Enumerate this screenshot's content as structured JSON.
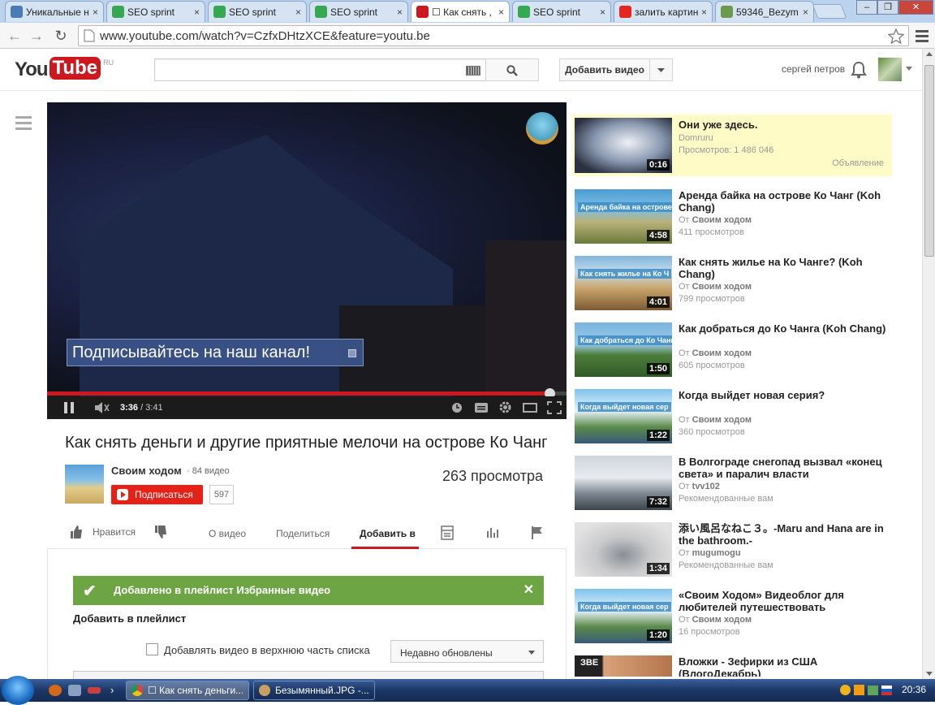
{
  "browser": {
    "tabs": [
      {
        "label": "Уникальные н",
        "icon": "site-icon",
        "color": "#4b7bb5",
        "active": false
      },
      {
        "label": "SEO sprint",
        "icon": "seosprint-icon",
        "color": "#36a852",
        "active": false
      },
      {
        "label": "SEO sprint",
        "icon": "seosprint-icon",
        "color": "#36a852",
        "active": false
      },
      {
        "label": "SEO sprint",
        "icon": "seosprint-icon",
        "color": "#36a852",
        "active": false
      },
      {
        "label": "☐ Как снять ,",
        "icon": "youtube-icon",
        "color": "#cc181e",
        "active": true
      },
      {
        "label": "SEO sprint",
        "icon": "seosprint-icon",
        "color": "#36a852",
        "active": false
      },
      {
        "label": "залить картин",
        "icon": "yandex-icon",
        "color": "#e52620",
        "active": false
      },
      {
        "label": "59346_Bezym",
        "icon": "image-icon",
        "color": "#6c9a4a",
        "active": false
      }
    ],
    "tab_close": "×",
    "window": {
      "minimize": "–",
      "restore": "❐",
      "close": "✕"
    },
    "url": "www.youtube.com/watch?v=CzfxDHtzXCE&feature=youtu.be"
  },
  "header": {
    "logo_you": "You",
    "logo_tube": "Tube",
    "logo_region": "RU",
    "add_video": "Добавить видео",
    "username": "сергей петров"
  },
  "player": {
    "annotation": "Подписывайтесь на наш канал!",
    "time_current": "3:36",
    "time_total": " / 3:41",
    "progress": 0.977
  },
  "video": {
    "title": "Как снять деньги и другие приятные мелочи на острове Ко Чанг",
    "channel": "Своим ходом",
    "channel_videos": "· 84 видео",
    "subscribe": "Подписаться",
    "subscribers": "597",
    "views": "263 просмотра"
  },
  "actions": {
    "like": "Нравится",
    "about": "О видео",
    "share": "Поделиться",
    "add_to": "Добавить в"
  },
  "playlist_panel": {
    "success": "Добавлено в плейлист Избранные видео",
    "heading": "Добавить в плейлист",
    "checkbox_label": "Добавлять видео в верхнюю часть списка",
    "sort": "Недавно обновлены"
  },
  "ad": {
    "title": "Они уже здесь.",
    "channel": "Domruru",
    "views": "Просмотров: 1 486 046",
    "label": "Объявление",
    "duration": "0:16"
  },
  "related": [
    {
      "title": "Аренда байка на острове Ко Чанг (Koh Chang)",
      "by_prefix": "От ",
      "channel": "Своим ходом",
      "views": "411 просмотров",
      "duration": "4:58",
      "thumb_text": "Аренда байка на острове"
    },
    {
      "title": "Как снять жилье на Ко Чанге? (Koh Chang)",
      "by_prefix": "От ",
      "channel": "Своим ходом",
      "views": "799 просмотров",
      "duration": "4:01",
      "thumb_text": "Как снять жилье на Ко Ч"
    },
    {
      "title": "Как добраться до Ко Чанга (Koh Chang)",
      "by_prefix": "От ",
      "channel": "Своим ходом",
      "views": "605 просмотров",
      "duration": "1:50",
      "thumb_text": "Как добраться до Ко Чанга?"
    },
    {
      "title": "Когда выйдет новая серия?",
      "by_prefix": "От ",
      "channel": "Своим ходом",
      "views": "360 просмотров",
      "duration": "1:22",
      "thumb_text": "Когда выйдет новая сер"
    },
    {
      "title": "В Волгограде снегопад вызвал «конец света» и паралич власти",
      "by_prefix": "От ",
      "channel": "tvv102",
      "views": "Рекомендованные вам",
      "duration": "7:32",
      "thumb_text": ""
    },
    {
      "title": "添い風呂なねこ３。-Maru and Hana are in the bathroom.-",
      "by_prefix": "От ",
      "channel": "mugumogu",
      "views": "Рекомендованные вам",
      "duration": "1:34",
      "thumb_text": ""
    },
    {
      "title": "«Своим Ходом» Видеоблог для любителей путешествовать",
      "by_prefix": "От ",
      "channel": "Своим ходом",
      "views": "16 просмотров",
      "duration": "1:20",
      "thumb_text": "Когда выйдет новая сер"
    },
    {
      "title": "Вложки - Зефирки из США (ВлогоДекабрь)",
      "by_prefix": "",
      "channel": "",
      "views": "",
      "duration": "",
      "thumb_text": "ЗВЕ"
    }
  ],
  "taskbar": {
    "tasks": [
      {
        "label": "☐ Как снять деньги...",
        "active": true
      },
      {
        "label": "Безымянный.JPG -...",
        "active": false
      }
    ],
    "more": "›",
    "clock": "20:36"
  }
}
